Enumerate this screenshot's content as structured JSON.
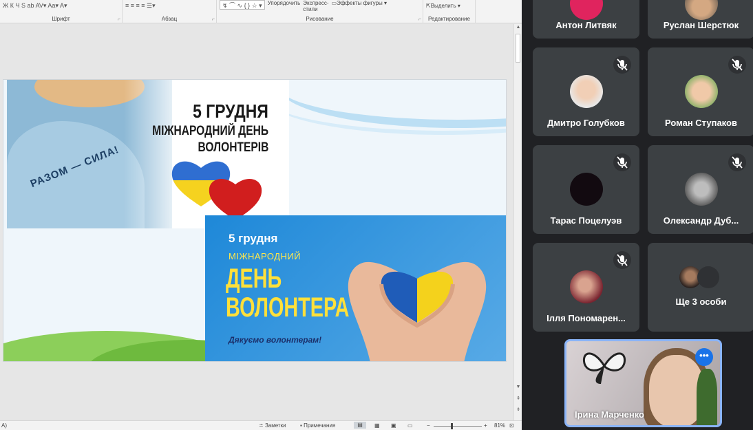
{
  "ribbon": {
    "groups": [
      {
        "label": "Шрифт",
        "buttons": "Ж  К  Ч  S  ab  AV▾  Aa▾   A▾"
      },
      {
        "label": "Абзац",
        "buttons": "≡  ≡  ≡  ≡   ☰▾"
      },
      {
        "label": "Рисование",
        "arrange": "Упорядочить",
        "quick_styles_1": "Экспресс-",
        "quick_styles_2": "стили",
        "effects": "Эффекты фигуры"
      },
      {
        "label": "Редактирование",
        "select": "Выделить"
      }
    ]
  },
  "statusbar": {
    "left": "A)",
    "notes": "Заметки",
    "comments": "Примечания",
    "zoom_minus": "−",
    "zoom_plus": "+",
    "zoom": "81%"
  },
  "slide": {
    "image1": {
      "shirt_text": "РАЗОМ — СИЛА!",
      "date": "5 ГРУДНЯ",
      "line2": "МІЖНАРОДНИЙ ДЕНЬ",
      "line3": "ВОЛОНТЕРІВ"
    },
    "image2": {
      "date": "5 грудня",
      "line2": "МІЖНАРОДНИЙ",
      "line3": "ДЕНЬ",
      "line4": "ВОЛОНТЕРА",
      "thanks": "Дякуємо волонтерам!"
    }
  },
  "meet": {
    "participants": [
      {
        "name": "Антон Литвяк"
      },
      {
        "name": "Руслан Шерстюк"
      },
      {
        "name": "Дмитро Голубков"
      },
      {
        "name": "Роман Ступаков"
      },
      {
        "name": "Тарас Поцелуэв"
      },
      {
        "name": "Олександр Дуб..."
      },
      {
        "name": "Ілля Пономарен..."
      },
      {
        "name": "Ще 3 особи"
      }
    ],
    "self": {
      "name": "Ірина Марченко",
      "more": "•••"
    },
    "colors": {
      "accent": "#8ab4f8",
      "tile": "#3c4043",
      "background": "#202124"
    }
  }
}
